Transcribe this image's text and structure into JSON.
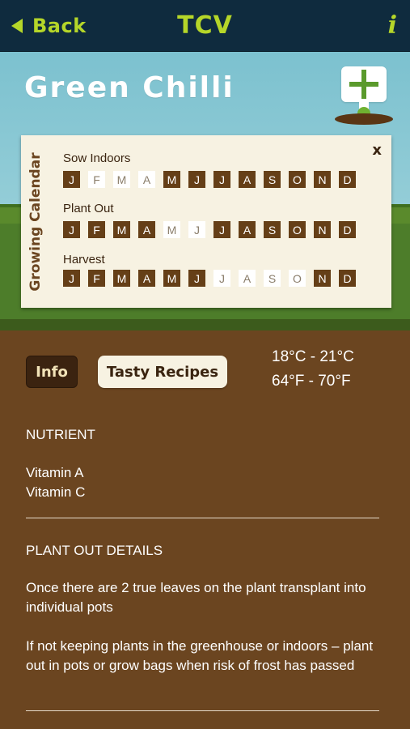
{
  "nav": {
    "back_label": "Back",
    "title": "TCV",
    "info_label": "i"
  },
  "hero": {
    "title": "Green Chilli"
  },
  "calendar": {
    "side_label": "Growing Calendar",
    "close_label": "x",
    "months": [
      "J",
      "F",
      "M",
      "A",
      "M",
      "J",
      "J",
      "A",
      "S",
      "O",
      "N",
      "D"
    ],
    "rows": [
      {
        "label": "Sow Indoors",
        "active": [
          true,
          false,
          false,
          false,
          true,
          true,
          true,
          true,
          true,
          true,
          true,
          true
        ]
      },
      {
        "label": "Plant Out",
        "active": [
          true,
          true,
          true,
          true,
          false,
          false,
          true,
          true,
          true,
          true,
          true,
          true
        ]
      },
      {
        "label": "Harvest",
        "active": [
          true,
          true,
          true,
          true,
          true,
          true,
          false,
          false,
          false,
          false,
          true,
          true
        ]
      }
    ]
  },
  "tabs": {
    "info": "Info",
    "recipes": "Tasty Recipes"
  },
  "temperature": {
    "celsius": "18°C - 21°C",
    "fahrenheit": "64°F - 70°F"
  },
  "nutrient": {
    "title": "NUTRIENT",
    "items": [
      "Vitamin A",
      "Vitamin C"
    ]
  },
  "plant_out": {
    "title": "PLANT OUT DETAILS",
    "paragraphs": [
      "Once there are 2 true leaves on the plant transplant into individual pots",
      "If not keeping plants in the greenhouse or indoors – plant out in pots or grow bags when risk of frost has passed"
    ]
  },
  "colors": {
    "accent": "#b5d629",
    "nav_bg": "#0f2b3e",
    "soil": "#6b4520",
    "month_on": "#653f17",
    "card": "#f7f2e2"
  }
}
